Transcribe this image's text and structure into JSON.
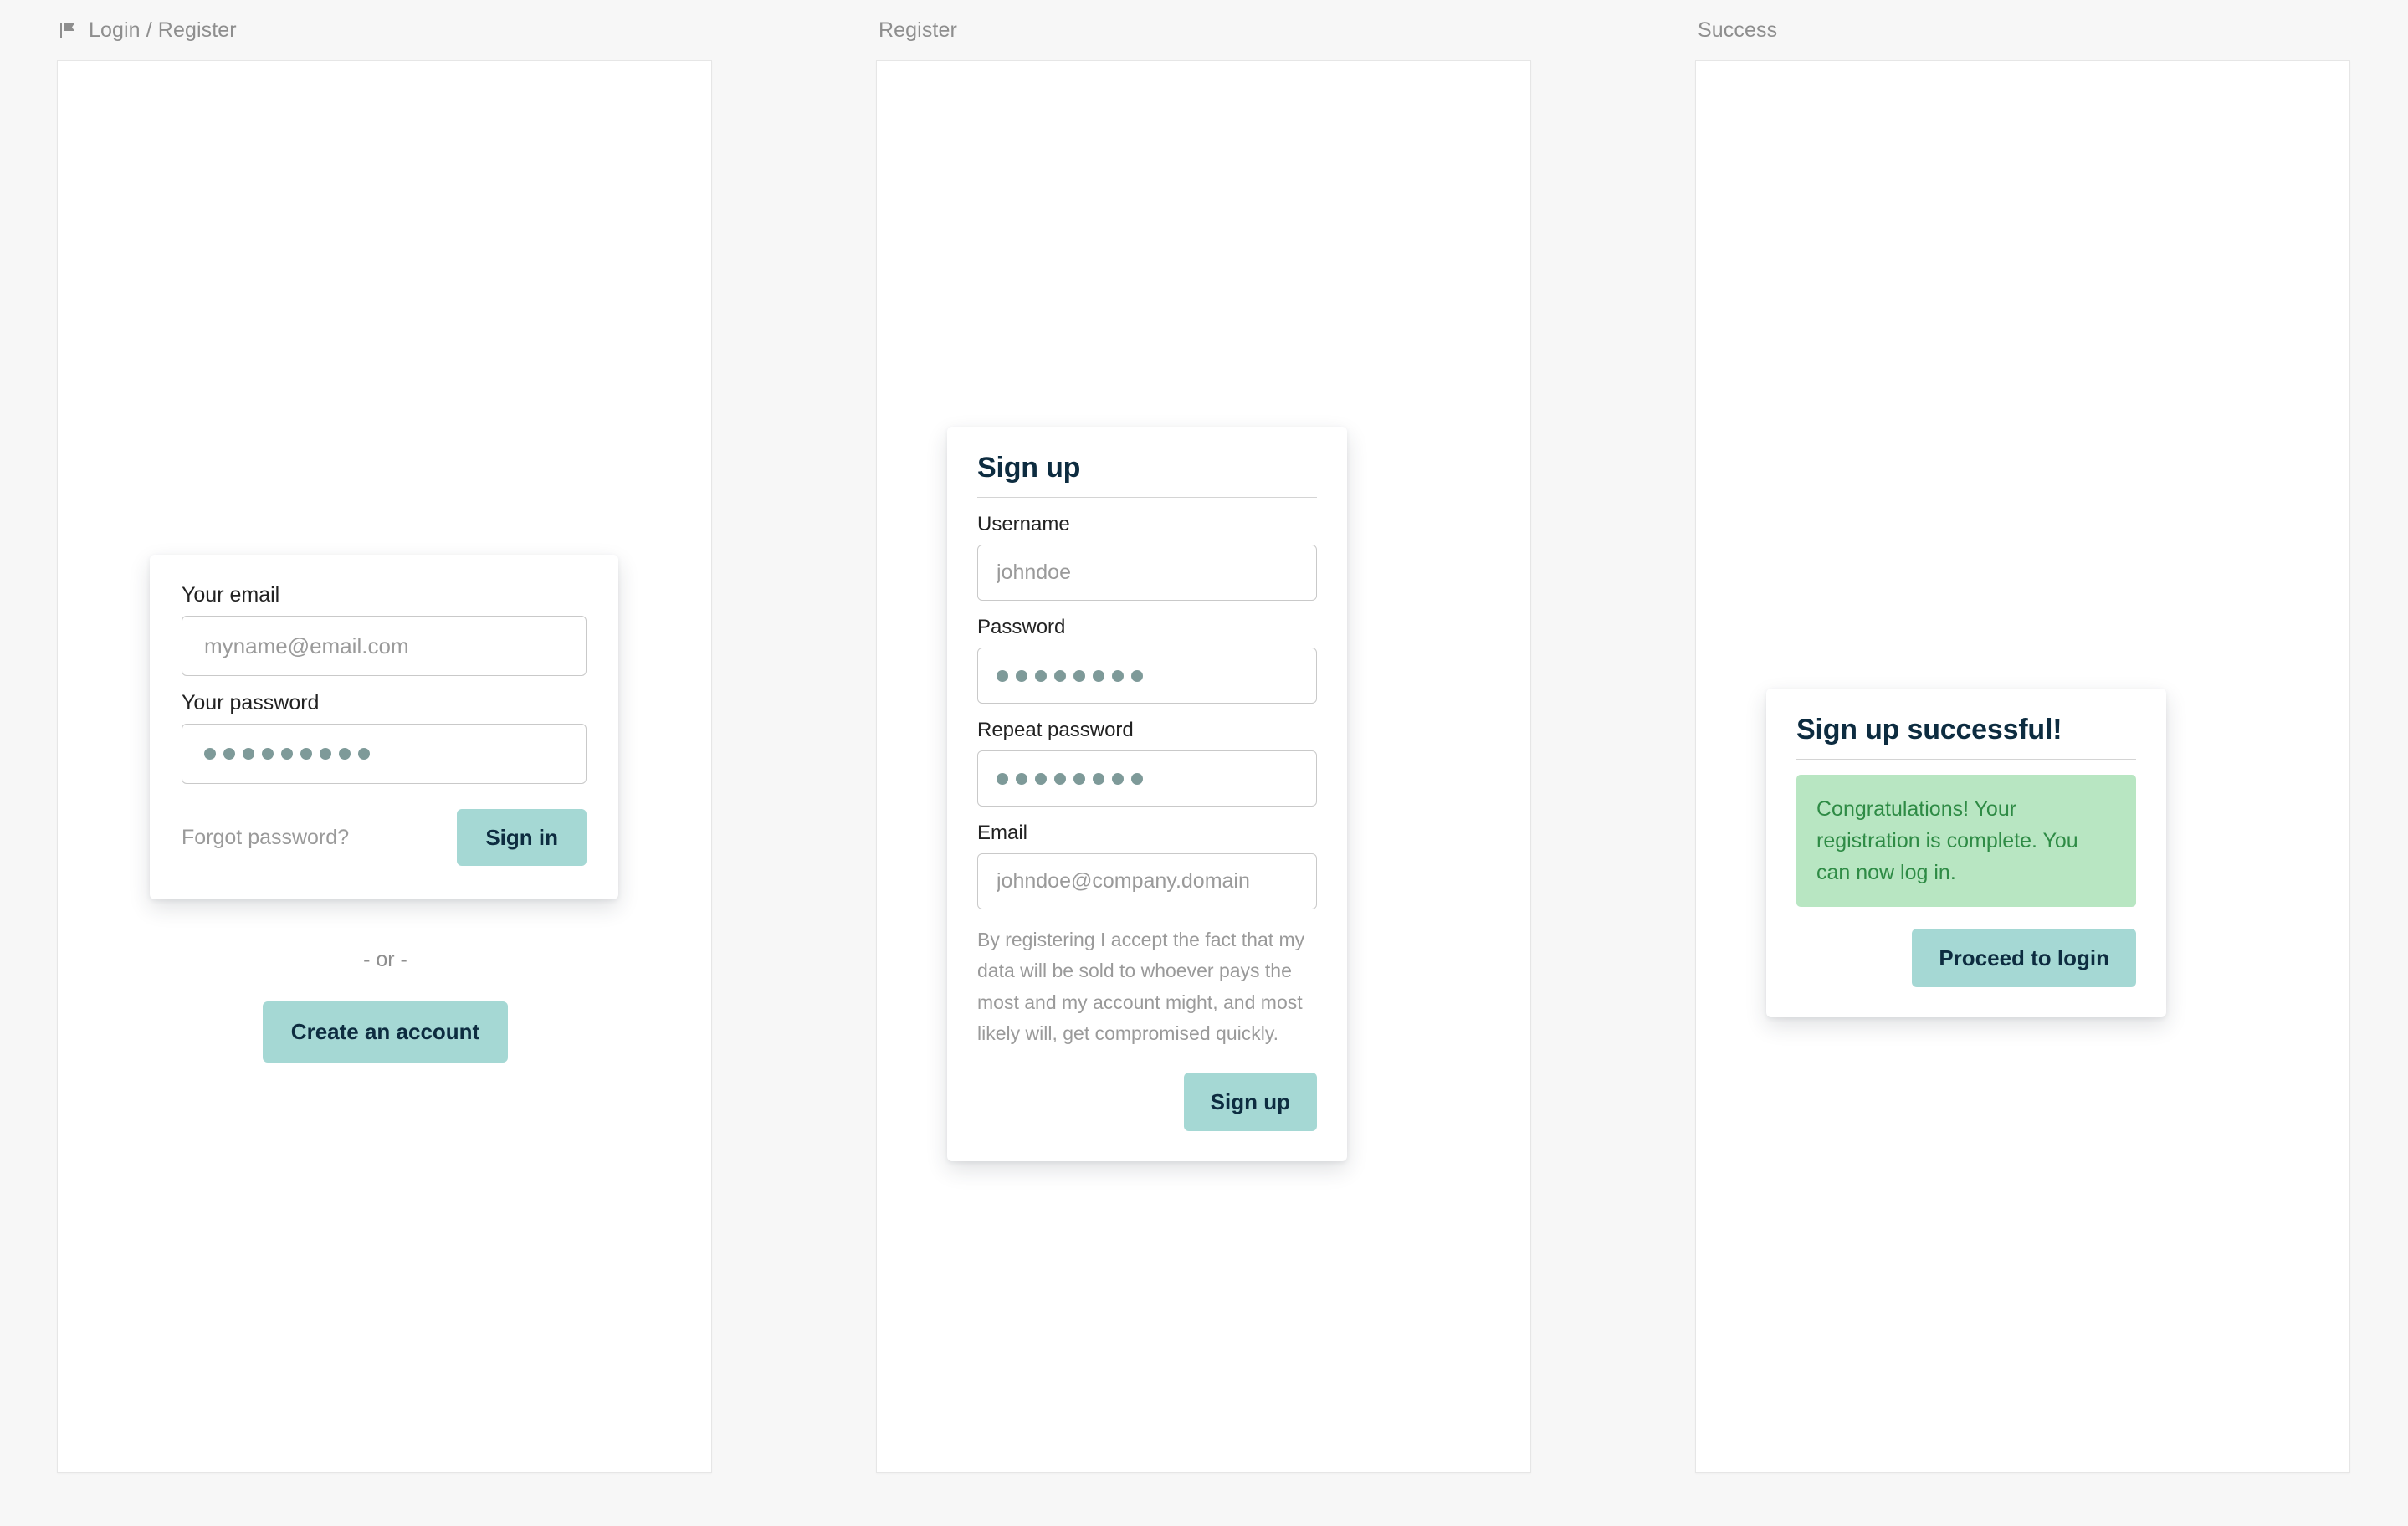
{
  "page": {
    "background_color": "#f7f7f7",
    "accent_color": "#a5d8d4",
    "accent_text_color": "#0d2c40",
    "success_bg_color": "#b8e6c2",
    "success_text_color": "#2e8b45"
  },
  "panels": [
    {
      "id": "login-register",
      "header_label": "Login / Register",
      "header_icon": "flag-icon"
    },
    {
      "id": "register",
      "header_label": "Register"
    },
    {
      "id": "success",
      "header_label": "Success"
    }
  ],
  "login": {
    "email": {
      "label": "Your email",
      "placeholder": "myname@email.com",
      "value": ""
    },
    "password": {
      "label": "Your password",
      "value": "••••••••",
      "dot_count": 9
    },
    "forgot_label": "Forgot password?",
    "signin_label": "Sign in",
    "or_label": "- or -",
    "create_account_label": "Create an account"
  },
  "signup": {
    "title": "Sign up",
    "username": {
      "label": "Username",
      "placeholder": "johndoe",
      "value": ""
    },
    "password": {
      "label": "Password",
      "value": "••••••••",
      "dot_count": 8
    },
    "repeat_password": {
      "label": "Repeat password",
      "value": "••••••••",
      "dot_count": 8
    },
    "email": {
      "label": "Email",
      "placeholder": "johndoe@company.domain",
      "value": ""
    },
    "legal_text": "By registering I accept the fact that my data will be sold to whoever pays the most and my account might, and most likely will, get compromised quickly.",
    "submit_label": "Sign up"
  },
  "success": {
    "title": "Sign up successful!",
    "message": "Congratulations! Your registration is complete. You can now log in.",
    "proceed_label": "Proceed to login"
  }
}
